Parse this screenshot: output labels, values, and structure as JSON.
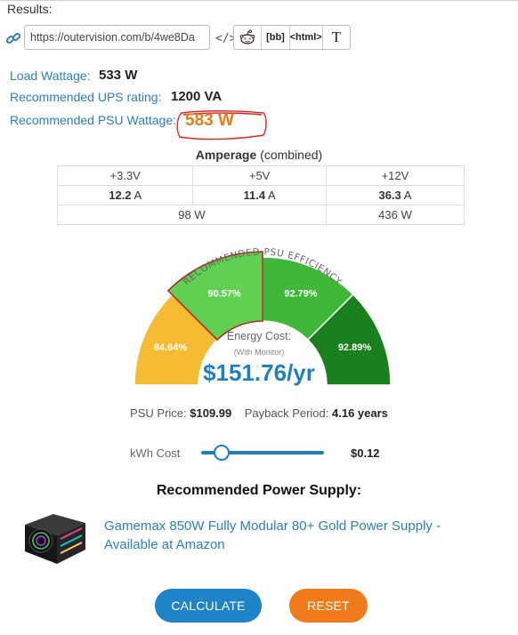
{
  "results": {
    "label": "Results:",
    "share_url": "https://outervision.com/b/4we8Da",
    "embed_label": "</>",
    "share_buttons": {
      "bbcode": "[bb]",
      "html": "<html>",
      "text": "T"
    }
  },
  "summary": {
    "load_label": "Load Wattage:",
    "load_value": "533 W",
    "ups_label": "Recommended UPS rating:",
    "ups_value": "1200 VA",
    "psu_label": "Recommended PSU Wattage:",
    "psu_value": "583 W"
  },
  "amperage": {
    "title": "Amperage",
    "title_suffix": "(combined)",
    "rails": [
      "+3.3V",
      "+5V",
      "+12V"
    ],
    "amps": [
      "12.2",
      "11.4",
      "36.3"
    ],
    "amp_unit": "A",
    "watts_low": "98 W",
    "watts_12v": "436 W"
  },
  "efficiency": {
    "arc_label": "RECOMMENDED PSU EFFICIENCY",
    "segments": [
      {
        "label": "84.64%",
        "color": "#f4bb33",
        "selected": false
      },
      {
        "label": "90.57%",
        "color": "#60cf52",
        "selected": true
      },
      {
        "label": "92.79%",
        "color": "#3fb739",
        "selected": false
      },
      {
        "label": "92.89%",
        "color": "#1a7f1d",
        "selected": false
      }
    ],
    "energy_label": "Energy Cost:",
    "energy_sub": "(With Monitor)",
    "energy_value": "$151.76/yr"
  },
  "price": {
    "psu_price_label": "PSU Price:",
    "psu_price_value": "$109.99",
    "payback_label": "Payback Period:",
    "payback_value": "4.16 years"
  },
  "kwh": {
    "label": "kWh Cost",
    "value": "$0.12",
    "level": 0.12
  },
  "recommendation": {
    "title": "Recommended Power Supply:",
    "product_link": "Gamemax 850W Fully Modular 80+ Gold Power Supply - Available at Amazon"
  },
  "actions": {
    "calculate": "CALCULATE",
    "reset": "RESET"
  },
  "colors": {
    "accent_blue": "#1f83c8",
    "accent_orange": "#f17b1a",
    "link_blue": "#2b7fc1"
  }
}
